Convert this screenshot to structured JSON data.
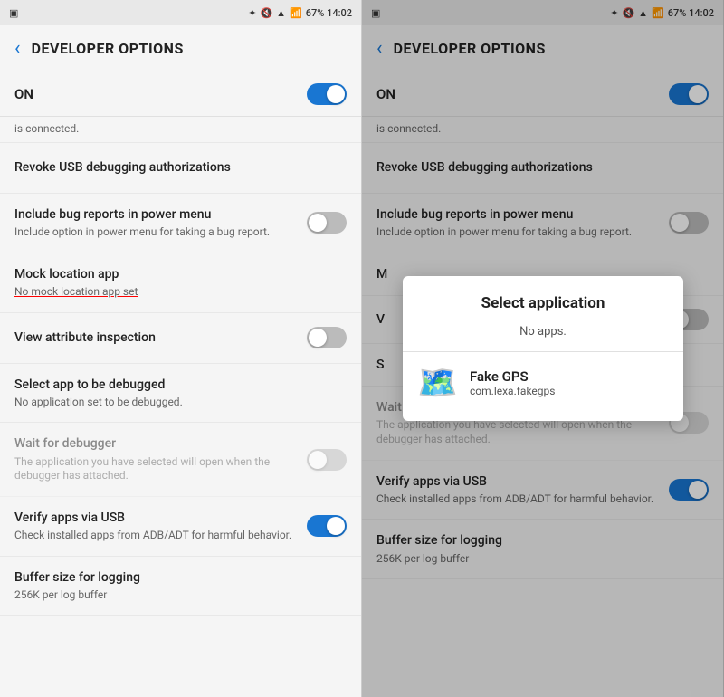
{
  "left_panel": {
    "status_bar": {
      "left_icons": "📷",
      "right_text": "67%  14:02",
      "bluetooth": "✦",
      "signal": "📶"
    },
    "header": {
      "back_icon": "‹",
      "title": "DEVELOPER OPTIONS"
    },
    "on_label": "ON",
    "is_connected": "is connected.",
    "settings": [
      {
        "id": "revoke-usb",
        "title": "Revoke USB debugging authorizations",
        "subtitle": "",
        "has_toggle": false,
        "toggle_on": false,
        "dimmed": false
      },
      {
        "id": "bug-reports",
        "title": "Include bug reports in power menu",
        "subtitle": "Include option in power menu for taking a bug report.",
        "has_toggle": true,
        "toggle_on": false,
        "dimmed": false
      },
      {
        "id": "mock-location",
        "title": "Mock location app",
        "subtitle": "No mock location app set",
        "subtitle_underline": true,
        "has_toggle": false,
        "toggle_on": false,
        "dimmed": false
      },
      {
        "id": "view-attribute",
        "title": "View attribute inspection",
        "subtitle": "",
        "has_toggle": true,
        "toggle_on": false,
        "dimmed": false
      },
      {
        "id": "select-debug-app",
        "title": "Select app to be debugged",
        "subtitle": "No application set to be debugged.",
        "has_toggle": false,
        "toggle_on": false,
        "dimmed": false
      },
      {
        "id": "wait-debugger",
        "title": "Wait for debugger",
        "subtitle": "The application you have selected will open when the debugger has attached.",
        "has_toggle": true,
        "toggle_on": false,
        "dimmed": true
      },
      {
        "id": "verify-apps-usb",
        "title": "Verify apps via USB",
        "subtitle": "Check installed apps from ADB/ADT for harmful behavior.",
        "has_toggle": true,
        "toggle_on": true,
        "dimmed": false
      },
      {
        "id": "buffer-size",
        "title": "Buffer size for logging",
        "subtitle": "256K per log buffer",
        "has_toggle": false,
        "toggle_on": false,
        "dimmed": false
      }
    ]
  },
  "right_panel": {
    "status_bar": {
      "right_text": "67%  14:02"
    },
    "header": {
      "back_icon": "‹",
      "title": "DEVELOPER OPTIONS"
    },
    "on_label": "ON",
    "is_connected": "is connected.",
    "dialog": {
      "title": "Select application",
      "no_apps": "No apps.",
      "app": {
        "name": "Fake GPS",
        "package": "com.lexa.fakegps",
        "icon_emoji": "🗺️"
      }
    },
    "settings": [
      {
        "id": "r-revoke-usb",
        "title": "Revoke USB debugging authorizations",
        "subtitle": "",
        "has_toggle": false,
        "toggle_on": false,
        "dimmed": false
      },
      {
        "id": "r-bug-reports",
        "title": "Include bug reports in power menu",
        "subtitle": "Include option in power menu for taking a bug report.",
        "has_toggle": true,
        "toggle_on": false,
        "dimmed": false
      },
      {
        "id": "r-mock-location",
        "title": "Mock location app",
        "subtitle": "",
        "has_toggle": false,
        "dimmed": false
      },
      {
        "id": "r-view-attribute",
        "title": "View attribute inspection",
        "subtitle": "",
        "has_toggle": true,
        "toggle_on": false,
        "dimmed": false,
        "partial": true
      },
      {
        "id": "r-select-debug-app",
        "title": "Select app to be debugged",
        "subtitle": "",
        "has_toggle": false,
        "dimmed": false,
        "partial": true
      },
      {
        "id": "r-wait-debugger",
        "title": "Wait for debugger",
        "subtitle": "The application you have selected will open when the debugger has attached.",
        "has_toggle": true,
        "toggle_on": false,
        "dimmed": true
      },
      {
        "id": "r-verify-apps-usb",
        "title": "Verify apps via USB",
        "subtitle": "Check installed apps from ADB/ADT for harmful behavior.",
        "has_toggle": true,
        "toggle_on": true,
        "dimmed": false
      },
      {
        "id": "r-buffer-size",
        "title": "Buffer size for logging",
        "subtitle": "256K per log buffer",
        "has_toggle": false,
        "toggle_on": false,
        "dimmed": false
      }
    ]
  }
}
